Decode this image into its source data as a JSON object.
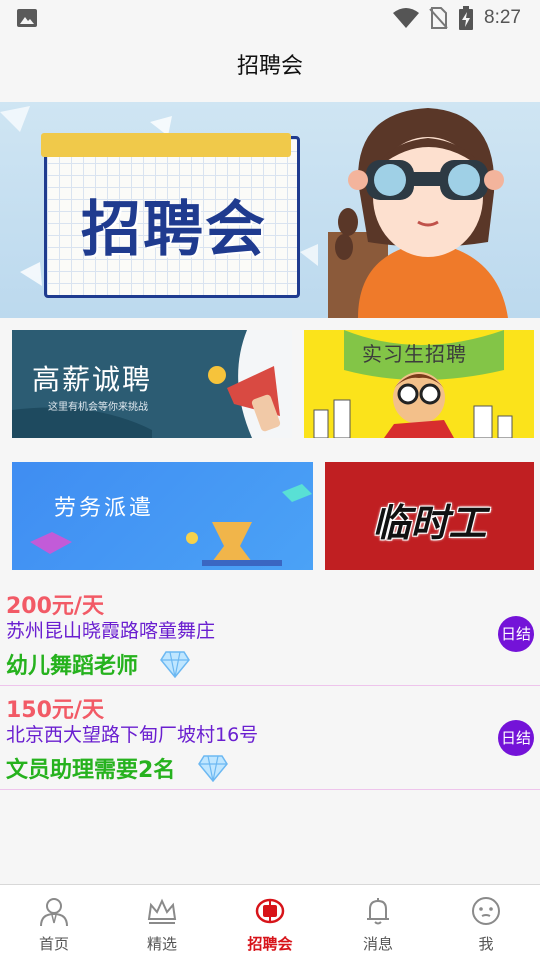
{
  "status_bar": {
    "time": "8:27",
    "icons": [
      "gallery-icon",
      "wifi-icon",
      "no-sim-icon",
      "battery-charging-icon"
    ]
  },
  "header": {
    "title": "招聘会"
  },
  "banner": {
    "title": "招聘会"
  },
  "tiles": [
    {
      "label": "高薪诚聘",
      "sublabel": "这里有机会等你来挑战"
    },
    {
      "label": "实习生招聘"
    },
    {
      "label": "劳务派遣"
    },
    {
      "label": "临时工"
    }
  ],
  "jobs": [
    {
      "salary": "200元/天",
      "address": "苏州昆山晓霞路喀童舞庄",
      "title": "幼儿舞蹈老师",
      "badge": "日结"
    },
    {
      "salary": "150元/天",
      "address": "北京西大望路下甸厂坡村16号",
      "title": "文员助理需要2名",
      "badge": "日结"
    }
  ],
  "bottom_nav": {
    "active_index": 2,
    "items": [
      {
        "label": "首页",
        "icon": "person-icon"
      },
      {
        "label": "精选",
        "icon": "crown-icon"
      },
      {
        "label": "招聘会",
        "icon": "pin-icon"
      },
      {
        "label": "消息",
        "icon": "bell-icon"
      },
      {
        "label": "我",
        "icon": "face-icon"
      }
    ]
  },
  "colors": {
    "salary": "#f25a66",
    "address": "#6a1fd0",
    "job_title": "#26b21e",
    "badge": "#7413d8",
    "nav_active": "#d7141a"
  }
}
